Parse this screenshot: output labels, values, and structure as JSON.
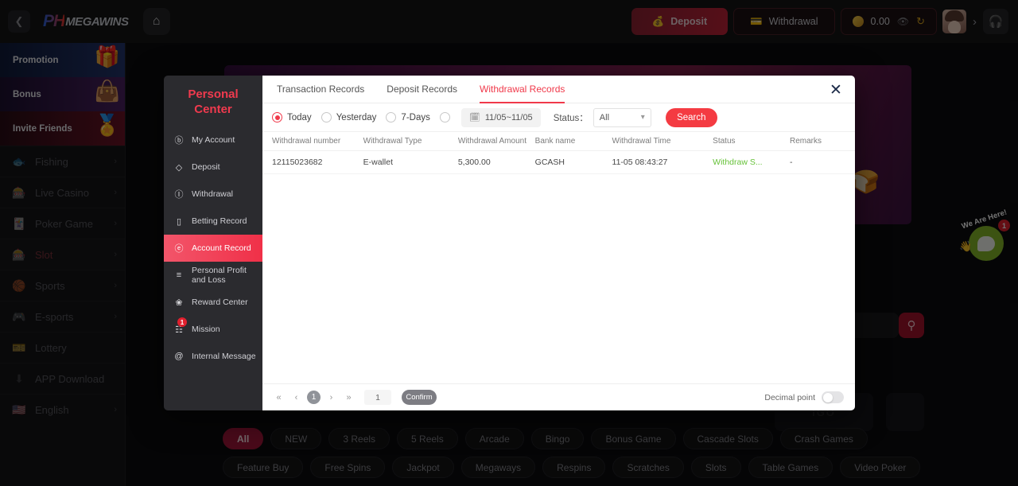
{
  "topbar": {
    "back_icon": "chevron-left-icon",
    "logo_ph": "PH",
    "logo_mega": "MEGAWINS",
    "home_icon": "home-icon",
    "deposit_label": "Deposit",
    "withdrawal_label": "Withdrawal",
    "balance_value": "0.00",
    "eye_icon": "eye-icon",
    "refresh_icon": "refresh-icon",
    "chevron_icon": "chevron-right-icon",
    "support_icon": "headset-icon"
  },
  "sidebar": {
    "promos": [
      {
        "label": "Promotion",
        "icon": "gift-icon",
        "glyph": "🎁"
      },
      {
        "label": "Bonus",
        "icon": "treasure-chest-icon",
        "glyph": "👜"
      },
      {
        "label": "Invite Friends",
        "icon": "medal-icon",
        "glyph": "🏅"
      }
    ],
    "items": [
      {
        "label": "Fishing",
        "icon": "fish-icon",
        "glyph": "🐟",
        "arrow": "›",
        "active": false
      },
      {
        "label": "Live Casino",
        "icon": "casino-chip-icon",
        "glyph": "🎰",
        "arrow": "›",
        "active": false
      },
      {
        "label": "Poker Game",
        "icon": "poker-cards-icon",
        "glyph": "🃏",
        "arrow": "›",
        "active": false
      },
      {
        "label": "Slot",
        "icon": "slot-machine-icon",
        "glyph": "🎰",
        "arrow": "›",
        "active": true
      },
      {
        "label": "Sports",
        "icon": "sports-icon",
        "glyph": "🏀",
        "arrow": "›",
        "active": false
      },
      {
        "label": "E-sports",
        "icon": "esports-icon",
        "glyph": "🎮",
        "arrow": "›",
        "active": false
      },
      {
        "label": "Lottery",
        "icon": "lottery-icon",
        "glyph": "🎫",
        "arrow": "",
        "active": false
      },
      {
        "label": "APP Download",
        "icon": "download-icon",
        "glyph": "⬇",
        "arrow": "",
        "active": false
      },
      {
        "label": "English",
        "icon": "flag-us-icon",
        "glyph": "🇺🇸",
        "arrow": "›",
        "active": false
      }
    ]
  },
  "background": {
    "search_icon": "search-icon",
    "tile_label": "IGO"
  },
  "chat_widget": {
    "banner": "We Are Here!",
    "badge": "1",
    "hand_icon": "waving-hand-icon",
    "bubble_icon": "chat-bubble-icon"
  },
  "chips": {
    "items": [
      {
        "label": "All",
        "active": true
      },
      {
        "label": "NEW",
        "active": false
      },
      {
        "label": "3 Reels",
        "active": false
      },
      {
        "label": "5 Reels",
        "active": false
      },
      {
        "label": "Arcade",
        "active": false
      },
      {
        "label": "Bingo",
        "active": false
      },
      {
        "label": "Bonus Game",
        "active": false
      },
      {
        "label": "Cascade Slots",
        "active": false
      },
      {
        "label": "Crash Games",
        "active": false
      },
      {
        "label": "Feature Buy",
        "active": false
      },
      {
        "label": "Free Spins",
        "active": false
      },
      {
        "label": "Jackpot",
        "active": false
      },
      {
        "label": "Megaways",
        "active": false
      },
      {
        "label": "Respins",
        "active": false
      },
      {
        "label": "Scratches",
        "active": false
      },
      {
        "label": "Slots",
        "active": false
      },
      {
        "label": "Table Games",
        "active": false
      },
      {
        "label": "Video Poker",
        "active": false
      }
    ]
  },
  "modal": {
    "title_line1": "Personal",
    "title_line2": "Center",
    "close_icon": "close-icon",
    "menu": [
      {
        "label": "My Account",
        "icon": "account-icon",
        "glyph": "ⓑ",
        "active": false,
        "badge": ""
      },
      {
        "label": "Deposit",
        "icon": "deposit-icon",
        "glyph": "◇",
        "active": false,
        "badge": ""
      },
      {
        "label": "Withdrawal",
        "icon": "withdrawal-icon",
        "glyph": "Ⓘ",
        "active": false,
        "badge": ""
      },
      {
        "label": "Betting Record",
        "icon": "clipboard-icon",
        "glyph": "▯",
        "active": false,
        "badge": ""
      },
      {
        "label": "Account Record",
        "icon": "account-record-icon",
        "glyph": "ⓔ",
        "active": true,
        "badge": ""
      },
      {
        "label": "Personal Profit and Loss",
        "icon": "profit-loss-icon",
        "glyph": "≡",
        "active": false,
        "badge": ""
      },
      {
        "label": "Reward Center",
        "icon": "reward-icon",
        "glyph": "❀",
        "active": false,
        "badge": ""
      },
      {
        "label": "Mission",
        "icon": "mission-icon",
        "glyph": "☷",
        "active": false,
        "badge": "1"
      },
      {
        "label": "Internal Message",
        "icon": "at-icon",
        "glyph": "@",
        "active": false,
        "badge": ""
      }
    ],
    "tabs": [
      {
        "label": "Transaction Records",
        "active": false
      },
      {
        "label": "Deposit Records",
        "active": false
      },
      {
        "label": "Withdrawal Records",
        "active": true
      }
    ],
    "filters": {
      "radios": [
        {
          "label": "Today",
          "selected": true
        },
        {
          "label": "Yesterday",
          "selected": false
        },
        {
          "label": "7-Days",
          "selected": false
        },
        {
          "label": "",
          "selected": false
        }
      ],
      "calendar_icon": "calendar-icon",
      "date_range": "11/05~11/05",
      "status_label": "Status：",
      "status_value": "All",
      "chevron_icon": "chevron-down-icon",
      "search_label": "Search"
    },
    "table": {
      "columns": [
        "Withdrawal number",
        "Withdrawal Type",
        "Withdrawal Amount",
        "Bank name",
        "Withdrawal Time",
        "Status",
        "Remarks"
      ],
      "rows": [
        {
          "number": "12115023682",
          "type": "E-wallet",
          "amount": "5,300.00",
          "bank": "GCASH",
          "time": "11-05 08:43:27",
          "status": "Withdraw S...",
          "remarks": "-"
        }
      ]
    },
    "footer": {
      "first_icon": "«",
      "prev_icon": "‹",
      "current_page": "1",
      "next_icon": "›",
      "last_icon": "»",
      "page_input": "1",
      "confirm_label": "Confirm",
      "decimal_label": "Decimal point"
    }
  },
  "colors": {
    "accent_red": "#f0394a",
    "deposit_red": "#c02338",
    "status_green": "#67c23a",
    "chip_active": "#a3183a"
  }
}
